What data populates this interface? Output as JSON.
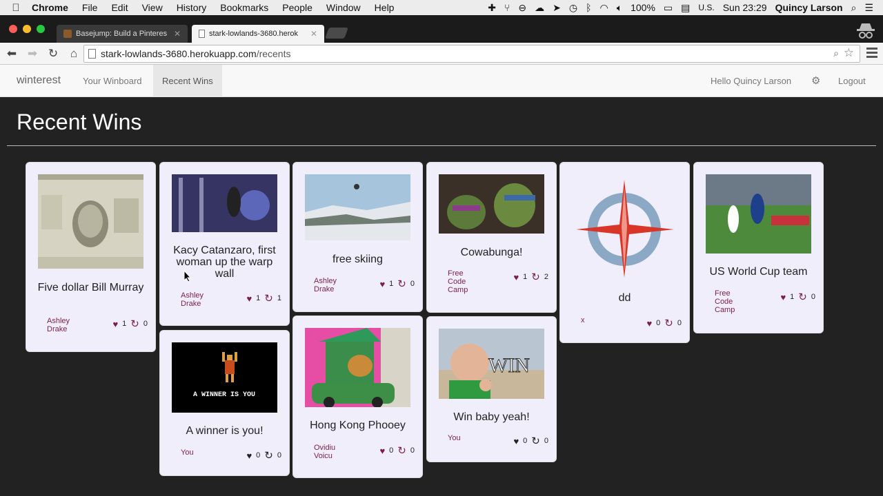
{
  "mac_menu": {
    "app": "Chrome",
    "items": [
      "File",
      "Edit",
      "View",
      "History",
      "Bookmarks",
      "People",
      "Window",
      "Help"
    ],
    "battery": "100%",
    "input_lang": "U.S.",
    "clock": "Sun 23:29",
    "user": "Quincy Larson"
  },
  "tabs": [
    {
      "title": "Basejump: Build a Pinteres"
    },
    {
      "title": "stark-lowlands-3680.herok"
    }
  ],
  "url": {
    "host": "stark-lowlands-3680.herokuapp.com",
    "path": "/recents"
  },
  "nav": {
    "brand": "winterest",
    "links": [
      "Your Winboard",
      "Recent Wins"
    ],
    "hello": "Hello Quincy Larson",
    "logout": "Logout"
  },
  "page_title": "Recent Wins",
  "cards": [
    {
      "caption": "Five dollar Bill Murray",
      "author": "Ashley Drake",
      "likes": "1",
      "rewins": "0"
    },
    {
      "caption": "Kacy Catanzaro, first woman up the warp wall",
      "author": "Ashley Drake",
      "likes": "1",
      "rewins": "1"
    },
    {
      "caption": "free skiing",
      "author": "Ashley Drake",
      "likes": "1",
      "rewins": "0"
    },
    {
      "caption": "Cowabunga!",
      "author": "Free Code Camp",
      "likes": "1",
      "rewins": "2"
    },
    {
      "caption": "dd",
      "author": "x",
      "likes": "0",
      "rewins": "0"
    },
    {
      "caption": "US World Cup team",
      "author": "Free Code Camp",
      "likes": "1",
      "rewins": "0"
    },
    {
      "caption": "A winner is you!",
      "author": "You",
      "likes": "0",
      "rewins": "0",
      "image_text": "A WINNER IS YOU"
    },
    {
      "caption": "Hong Kong Phooey",
      "author": "Ovidiu Voicu",
      "likes": "0",
      "rewins": "0"
    },
    {
      "caption": "Win baby yeah!",
      "author": "You",
      "likes": "0",
      "rewins": "0",
      "image_text": "WIN"
    }
  ],
  "colors": {
    "accent": "#7b1e46",
    "card_bg": "#f0eefb",
    "page_bg": "#222222"
  }
}
